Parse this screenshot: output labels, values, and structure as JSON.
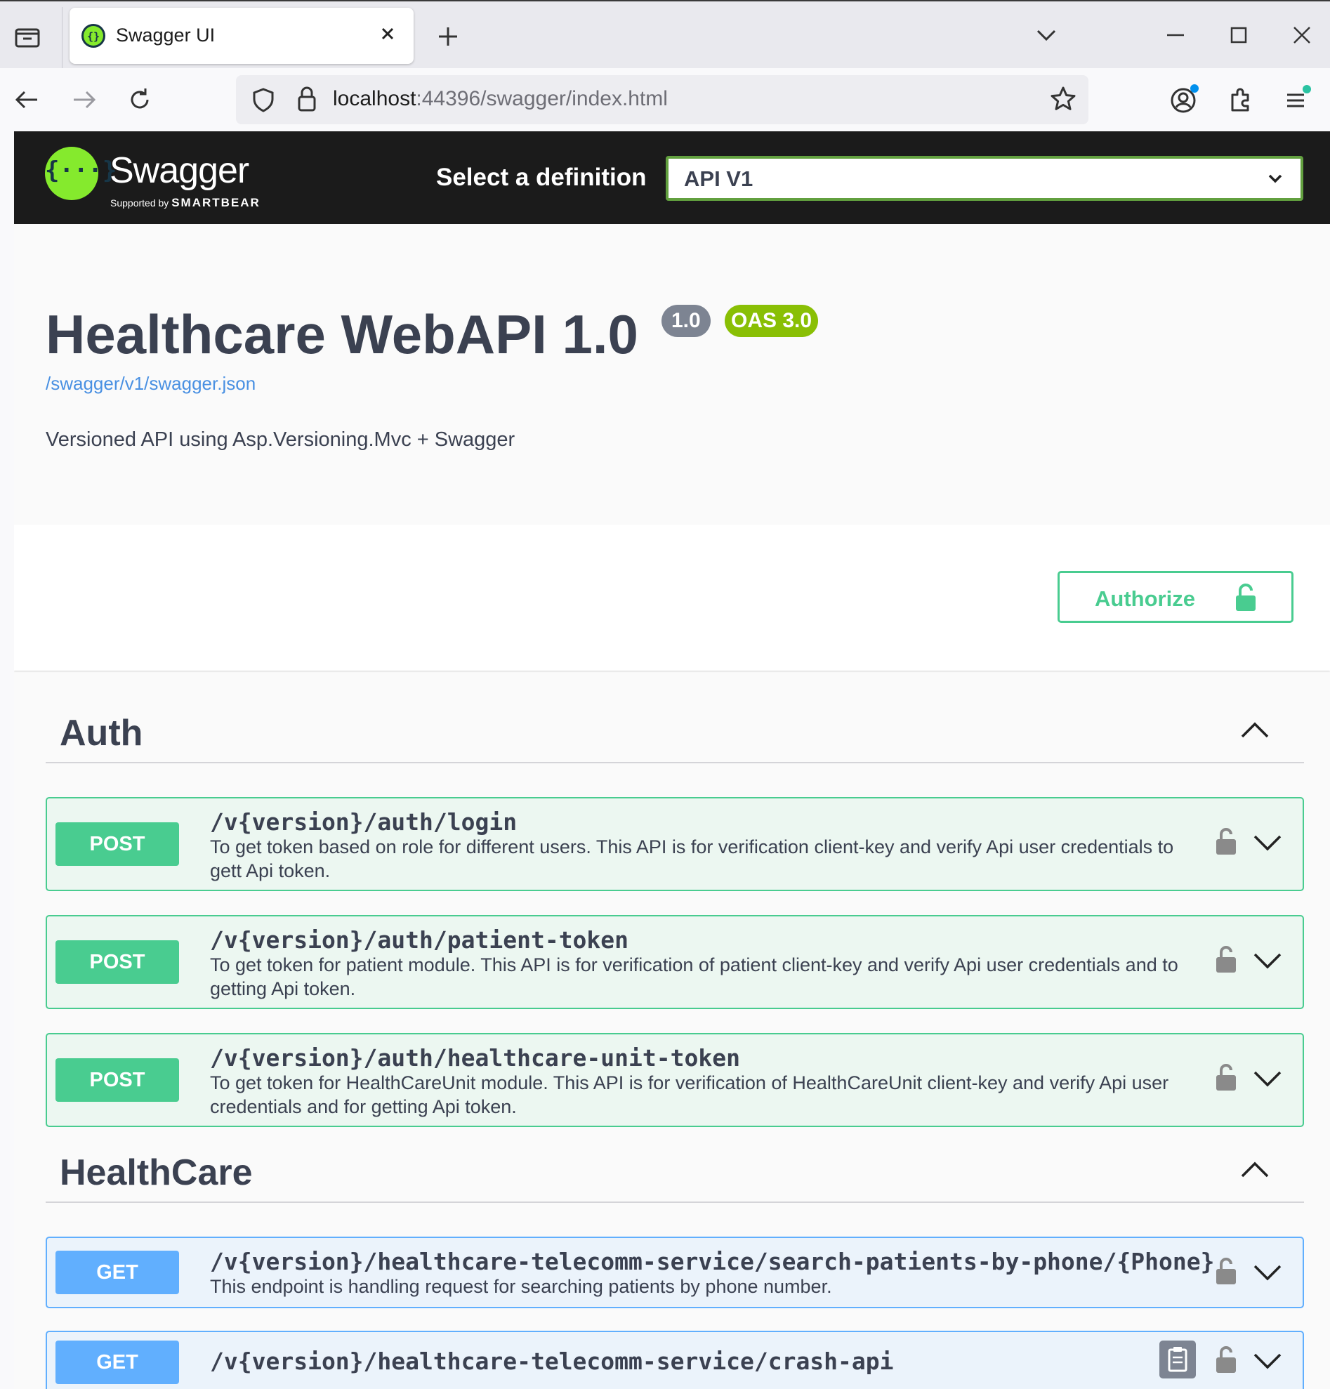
{
  "browser": {
    "tab_title": "Swagger UI",
    "url_host": "localhost",
    "url_rest": ":44396/swagger/index.html"
  },
  "swagger": {
    "logo_text": "Swagger",
    "logo_supported": "Supported by",
    "logo_smartbear": "SMARTBEAR",
    "definition_label": "Select a definition",
    "definition_value": "API V1"
  },
  "info": {
    "title": "Healthcare WebAPI 1.0",
    "version_badge": "1.0",
    "oas_badge": "OAS 3.0",
    "spec_link": "/swagger/v1/swagger.json",
    "description": "Versioned API using Asp.Versioning.Mvc + Swagger"
  },
  "authorize": {
    "label": "Authorize"
  },
  "tags": [
    {
      "name": "Auth",
      "operations": [
        {
          "method": "POST",
          "path": "/v{version}/auth/login",
          "description": "To get token based on role for different users. This API is for verification client-key and verify Api user credentials to gett Api token."
        },
        {
          "method": "POST",
          "path": "/v{version}/auth/patient-token",
          "description": "To get token for patient module. This API is for verification of patient client-key and verify Api user credentials and to getting Api token."
        },
        {
          "method": "POST",
          "path": "/v{version}/auth/healthcare-unit-token",
          "description": "To get token for HealthCareUnit module. This API is for verification of HealthCareUnit client-key and verify Api user credentials and for getting Api token."
        }
      ]
    },
    {
      "name": "HealthCare",
      "operations": [
        {
          "method": "GET",
          "path": "/v{version}/healthcare-telecomm-service/search-patients-by-phone/{Phone}",
          "description": "This endpoint is handling request for searching patients by phone number."
        },
        {
          "method": "GET",
          "path": "/v{version}/healthcare-telecomm-service/crash-api",
          "description": ""
        }
      ]
    }
  ],
  "colors": {
    "post": "#49cc90",
    "get": "#61affe",
    "swagger_green": "#85ea2d",
    "topbar": "#1b1b1b"
  }
}
